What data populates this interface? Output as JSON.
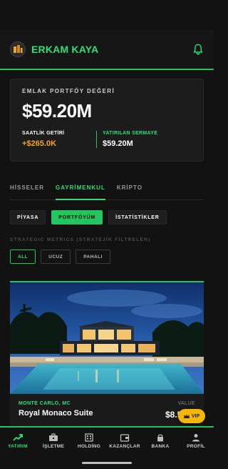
{
  "header": {
    "brand_name": "ERKAM KAYA",
    "accent_color": "#2ee07a",
    "logo_icon": "crest-logo-icon",
    "notification_icon": "bell-icon"
  },
  "portfolio": {
    "label": "EMLAK PORTFÖY DEĞERİ",
    "value": "$59.20M",
    "hourly_label": "SAATLİK GETİRİ",
    "hourly_value": "+$265.0K",
    "invested_label": "YATIRILAN SERMAYE",
    "invested_value": "$59.20M"
  },
  "tabs": [
    {
      "label": "HİSSELER",
      "active": false
    },
    {
      "label": "GAYRİMENKUL",
      "active": true
    },
    {
      "label": "KRİPTO",
      "active": false
    }
  ],
  "subtabs": [
    {
      "label": "PİYASA",
      "active": false
    },
    {
      "label": "PORTFÖYÜM",
      "active": true
    },
    {
      "label": "İSTATİSTİKLER",
      "active": false
    }
  ],
  "filters": {
    "title": "STRATEGIC METRICS (STRATEJİK FİLTRELER)",
    "chips": [
      {
        "label": "ALL",
        "active": true
      },
      {
        "label": "UCUZ",
        "active": false
      },
      {
        "label": "PAHALI",
        "active": false
      }
    ]
  },
  "listing": {
    "location": "MONTE CARLO, MC",
    "name": "Royal Monaco Suite",
    "value_label": "VALUE",
    "value": "$8.5"
  },
  "vip": {
    "label": "VIP",
    "icon": "crown-icon"
  },
  "bottom_nav": [
    {
      "label": "YATIRIM",
      "icon": "trend-up-icon",
      "active": true
    },
    {
      "label": "İŞLETME",
      "icon": "briefcase-icon",
      "active": false
    },
    {
      "label": "HOLDİNG",
      "icon": "building-icon",
      "active": false
    },
    {
      "label": "KAZANÇLAR",
      "icon": "wallet-icon",
      "active": false
    },
    {
      "label": "BANKA",
      "icon": "lock-icon",
      "active": false
    },
    {
      "label": "PROFİL",
      "icon": "user-icon",
      "active": false
    }
  ]
}
